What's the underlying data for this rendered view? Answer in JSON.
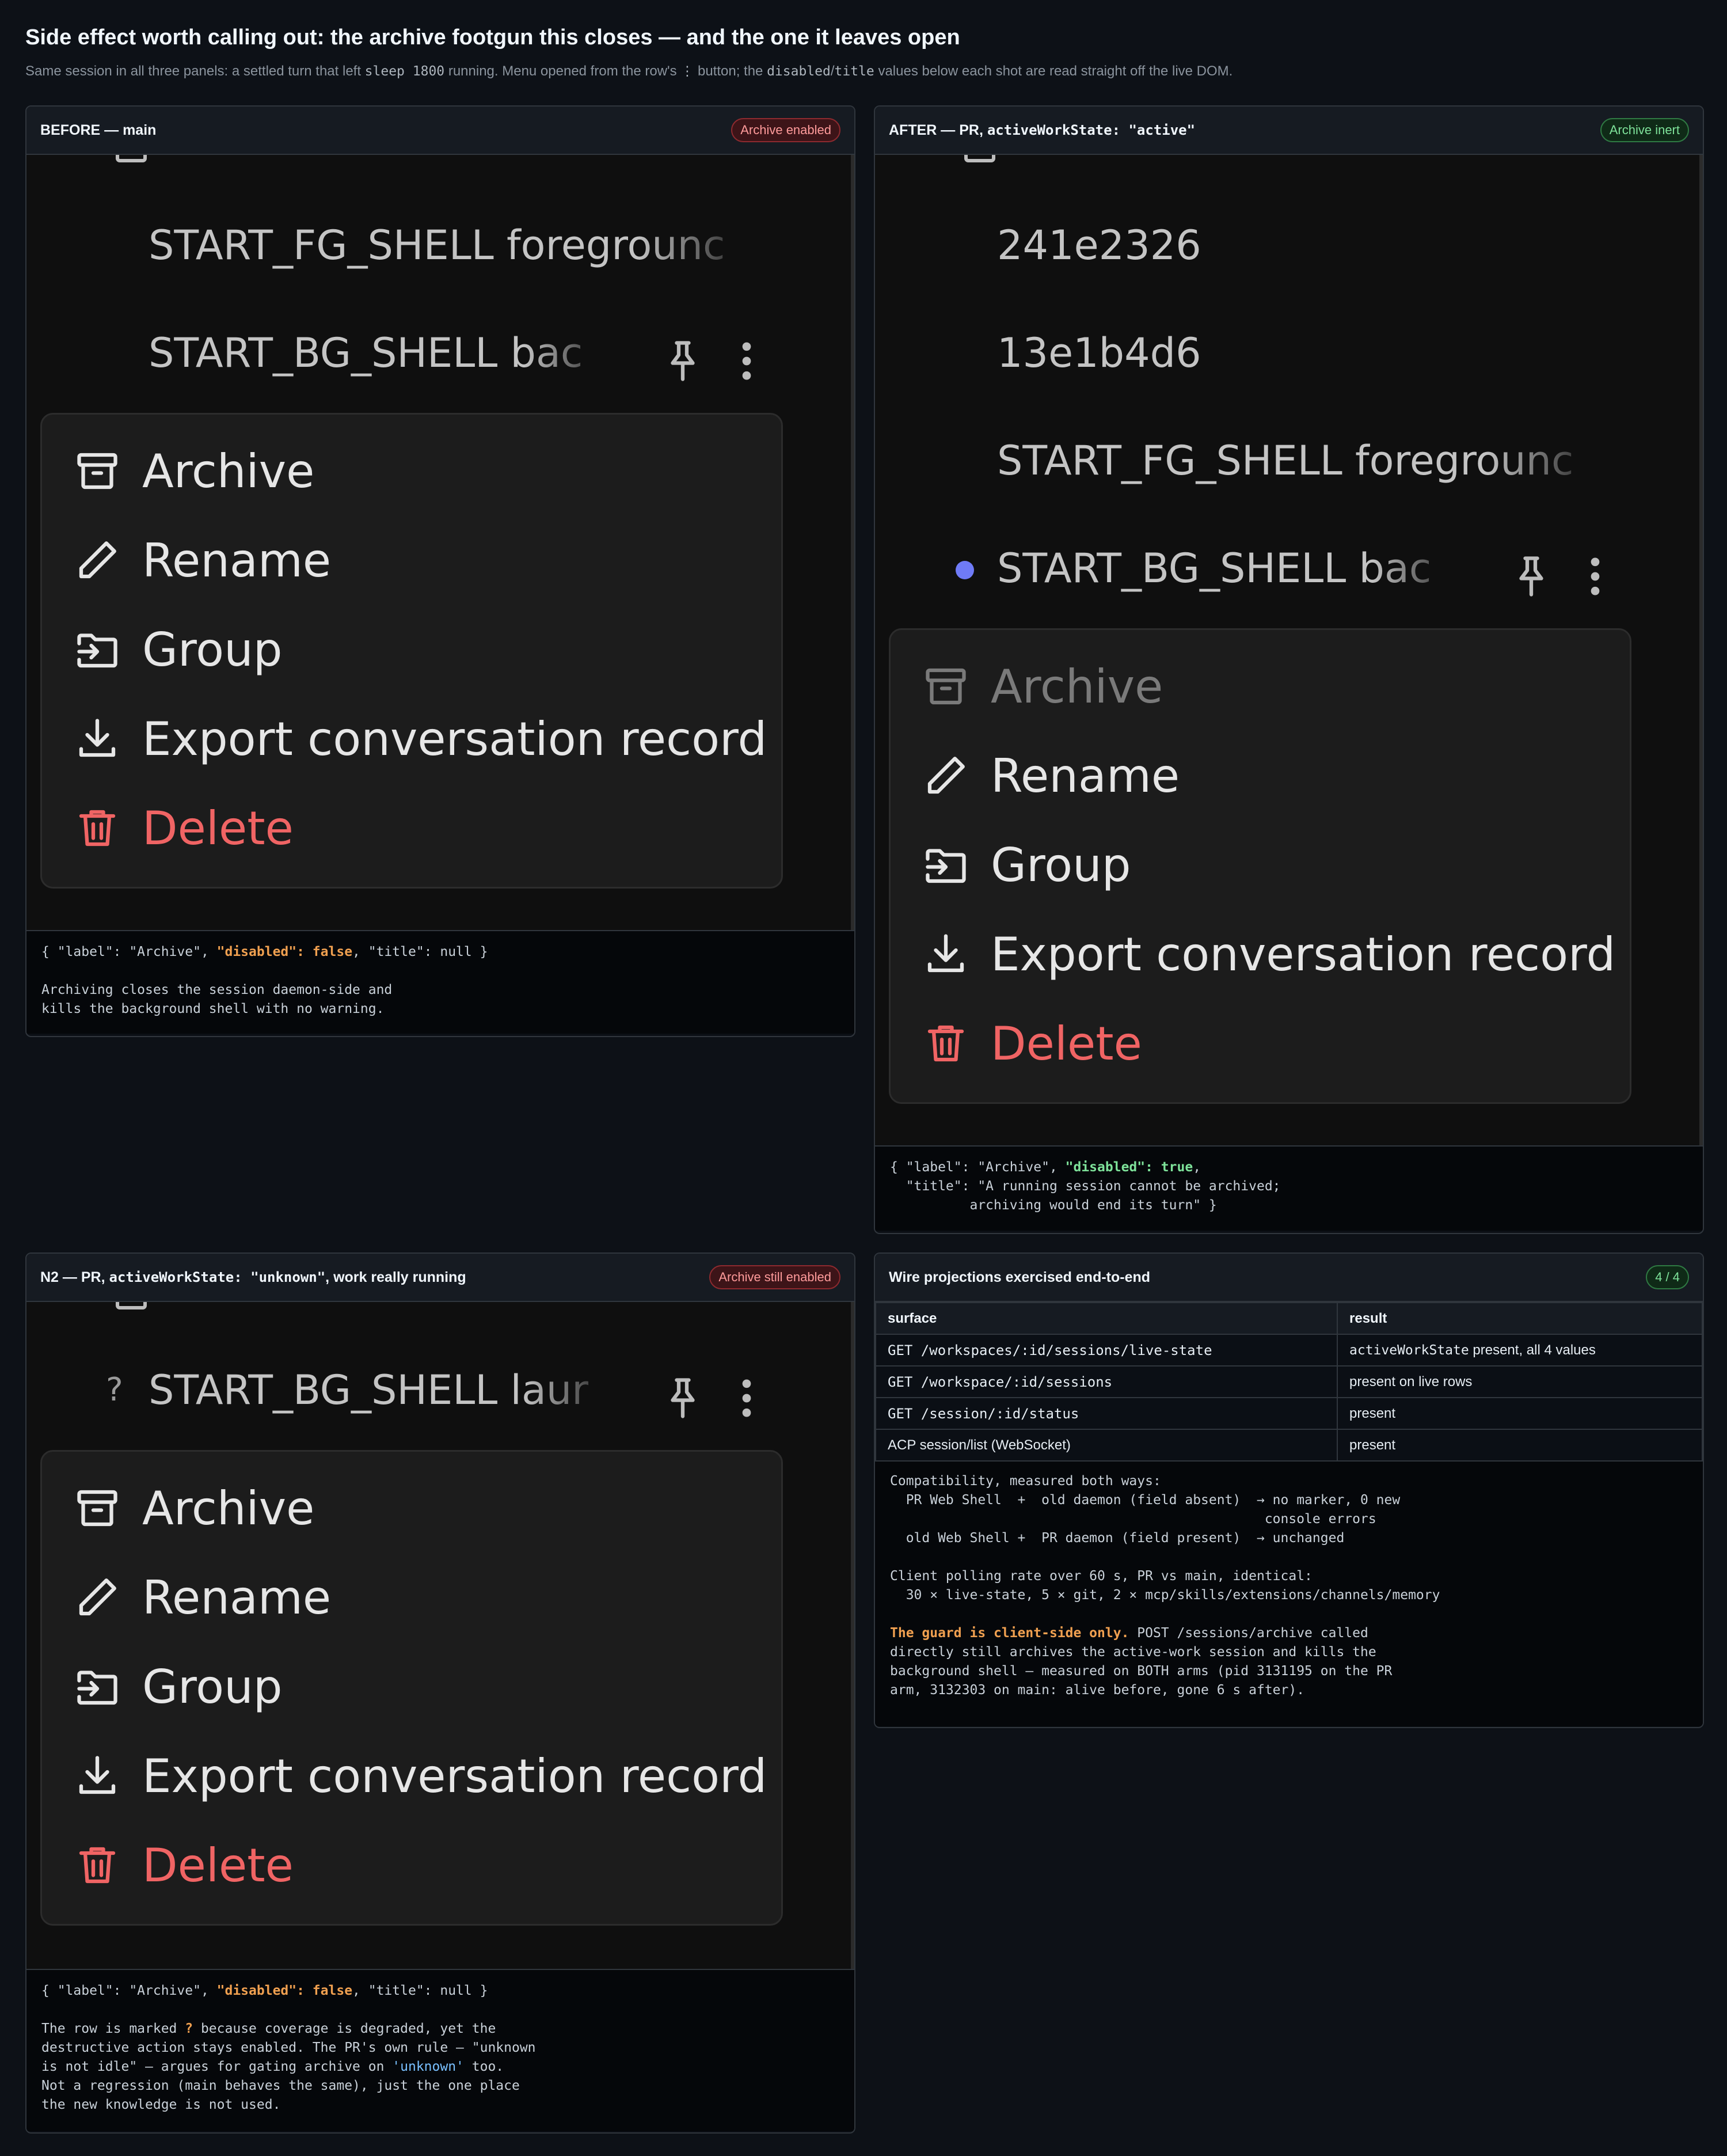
{
  "page": {
    "title": "Side effect worth calling out: the archive footgun this closes — and the one it leaves open",
    "subtitle_parts": [
      "Same session in all three panels: a settled turn that left ",
      "sleep 1800",
      " running. Menu opened from the row's ",
      "⋮",
      " button; the ",
      "disabled",
      "/",
      "title",
      " values below each shot are read straight off the live DOM."
    ]
  },
  "menu": {
    "archive": "Archive",
    "rename": "Rename",
    "group": "Group",
    "export": "Export conversation record",
    "delete": "Delete"
  },
  "before": {
    "title": "BEFORE — main",
    "badge": "Archive enabled",
    "rows": [
      "START_FG_SHELL foregrounc",
      "START_BG_SHELL bac"
    ],
    "json_open": "{ \"label\": \"Archive\", ",
    "json_key": "\"disabled\": false",
    "json_close": ", \"title\": null }",
    "note": "Archiving closes the session daemon-side and\nkills the background shell with no warning."
  },
  "after": {
    "title_prefix": "AFTER — PR, ",
    "title_code": "activeWorkState: \"active\"",
    "badge": "Archive inert",
    "rows": [
      "241e2326",
      "13e1b4d6",
      "START_FG_SHELL foregrounc",
      "START_BG_SHELL bac"
    ],
    "json_open": "{ \"label\": \"Archive\", ",
    "json_key": "\"disabled\": true",
    "json_close": ",\n  \"title\": \"A running session cannot be archived;\n          archiving would end its turn\" }"
  },
  "n2": {
    "title_prefix": "N2 — PR, ",
    "title_code": "activeWorkState: \"unknown\"",
    "title_suffix": ", work really running",
    "badge": "Archive still enabled",
    "row_marker": "?",
    "row": "START_BG_SHELL laur",
    "json_open": "{ \"label\": \"Archive\", ",
    "json_key": "\"disabled\": false",
    "json_close": ", \"title\": null }",
    "note_a": "The row is marked ",
    "note_q": "?",
    "note_b": " because coverage is degraded, yet the\ndestructive action stays enabled. The PR's own rule — \"unknown\nis not idle\" — argues for gating archive on ",
    "note_unknown": "'unknown'",
    "note_c": " too.\nNot a regression (main behaves the same), just the one place\nthe new knowledge is not used."
  },
  "wire": {
    "title": "Wire projections exercised end-to-end",
    "badge": "4 / 4",
    "headers": [
      "surface",
      "result"
    ],
    "rows": [
      {
        "surface": "GET /workspaces/:id/sessions/live-state",
        "result_code": "activeWorkState",
        "result_text": " present, all 4 values"
      },
      {
        "surface": "GET /workspace/:id/sessions",
        "result_code": "",
        "result_text": "present on live rows"
      },
      {
        "surface": "GET /session/:id/status",
        "result_code": "",
        "result_text": "present"
      },
      {
        "surface": "ACP session/list (WebSocket)",
        "result_code": "",
        "result_text": "present"
      }
    ],
    "compat": "Compatibility, measured both ways:\n  PR Web Shell  +  old daemon (field absent)  → no marker, 0 new\n                                               console errors\n  old Web Shell +  PR daemon (field present)  → unchanged\n\nClient polling rate over 60 s, PR vs main, identical:\n  30 × live-state, 5 × git, 2 × mcp/skills/extensions/channels/memory",
    "guard_label": "The guard is client-side only.",
    "guard_text": " POST /sessions/archive called\ndirectly still archives the active-work session and kills the\nbackground shell — measured on BOTH arms (pid 3131195 on the PR\narm, 3132303 on main: alive before, gone 6 s after)."
  }
}
